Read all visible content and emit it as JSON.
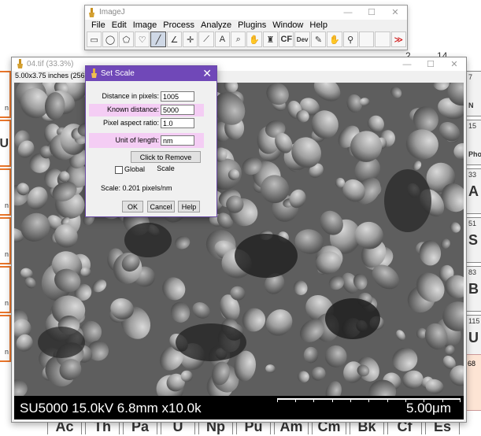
{
  "background": {
    "top_numbers": [
      "2",
      "14"
    ],
    "left_cells": [
      "n",
      "U",
      "n",
      "n",
      "n",
      "n"
    ],
    "right_cells": [
      {
        "num": "7",
        "sym": "N"
      },
      {
        "num": "15",
        "sym": "Pho"
      },
      {
        "num": "33",
        "sym": "A"
      },
      {
        "num": "51",
        "sym": "S"
      },
      {
        "num": "83",
        "sym": "B"
      },
      {
        "num": "115",
        "sym": "U"
      }
    ],
    "right_bottom": "68",
    "bottom_elements": [
      "Ac",
      "Th",
      "Pa",
      "U",
      "Np",
      "Pu",
      "Am",
      "Cm",
      "Bk",
      "Cf",
      "Es"
    ]
  },
  "imagej": {
    "title": "ImageJ",
    "menu": [
      "File",
      "Edit",
      "Image",
      "Process",
      "Analyze",
      "Plugins",
      "Window",
      "Help"
    ],
    "tools": [
      {
        "name": "rectangle-tool-icon",
        "glyph": "▭"
      },
      {
        "name": "oval-tool-icon",
        "glyph": "◯"
      },
      {
        "name": "polygon-tool-icon",
        "glyph": "⬠"
      },
      {
        "name": "freehand-tool-icon",
        "glyph": "♡"
      },
      {
        "name": "line-tool-icon",
        "glyph": "╱"
      },
      {
        "name": "angle-tool-icon",
        "glyph": "∠"
      },
      {
        "name": "point-tool-icon",
        "glyph": "✛"
      },
      {
        "name": "wand-tool-icon",
        "glyph": "⟋"
      },
      {
        "name": "text-tool-icon",
        "glyph": "A"
      },
      {
        "name": "magnifier-tool-icon",
        "glyph": "⌕"
      },
      {
        "name": "hand-tool-icon",
        "glyph": "✋"
      },
      {
        "name": "dropper-tool-icon",
        "glyph": "♜"
      },
      {
        "name": "cf-tool-icon",
        "glyph": "CF"
      },
      {
        "name": "dev-tool-icon",
        "glyph": "Dev"
      },
      {
        "name": "pencil-tool-icon",
        "glyph": "✎"
      },
      {
        "name": "brush-tool-icon",
        "glyph": "✋"
      },
      {
        "name": "flood-tool-icon",
        "glyph": "⚲"
      }
    ],
    "more_tools": "≫"
  },
  "image_window": {
    "title": "04.tif (33.3%)",
    "info": "5.00x3.75 inches (2560x",
    "sem_left": "SU5000 15.0kV 6.8mm x10.0k",
    "sem_right": "5.00μm"
  },
  "dialog": {
    "title": "Set Scale",
    "distance_label": "Distance in pixels:",
    "distance_value": "1005",
    "known_label": "Known distance:",
    "known_value": "5000",
    "aspect_label": "Pixel aspect ratio:",
    "aspect_value": "1.0",
    "unit_label": "Unit of length:",
    "unit_value": "nm",
    "remove_button": "Click to Remove Scale",
    "global_label": "Global",
    "scale_text": "Scale: 0.201 pixels/nm",
    "ok": "OK",
    "cancel": "Cancel",
    "help": "Help"
  },
  "colors": {
    "dialog_title": "#7048b8",
    "highlight": "#f4cdf4",
    "tile_orange": "#e8752a"
  }
}
